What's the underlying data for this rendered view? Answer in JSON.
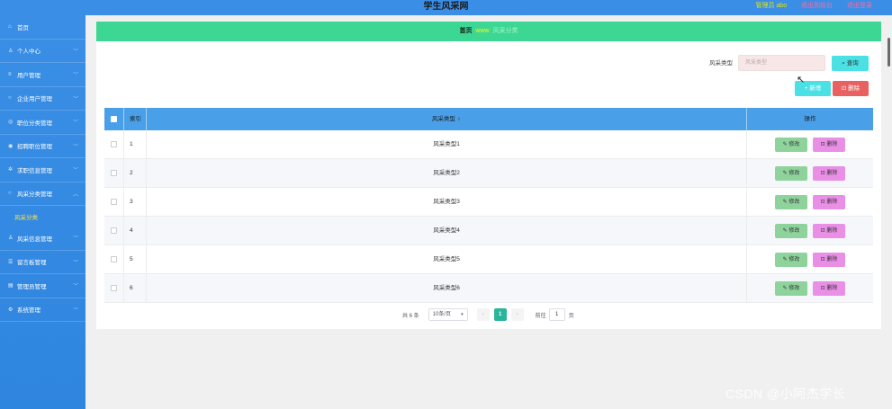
{
  "header": {
    "title": "学生风采网",
    "admin_label": "管理员 abo",
    "link1": "退出到前台",
    "link2": "退出登录"
  },
  "sidebar": {
    "items": [
      {
        "label": "首页",
        "icon": "home-icon"
      },
      {
        "label": "个人中心",
        "icon": "user-icon"
      },
      {
        "label": "用户管理",
        "icon": "users-icon"
      },
      {
        "label": "企业用户管理",
        "icon": "building-icon"
      },
      {
        "label": "职位分类管理",
        "icon": "category-icon"
      },
      {
        "label": "招聘职位管理",
        "icon": "briefcase-icon"
      },
      {
        "label": "求职信息管理",
        "icon": "info-icon"
      },
      {
        "label": "风采分类管理",
        "icon": "tag-icon"
      },
      {
        "label": "风采分类",
        "icon": ""
      },
      {
        "label": "风采信息管理",
        "icon": "star-icon"
      },
      {
        "label": "留言板管理",
        "icon": "message-icon"
      },
      {
        "label": "管理员管理",
        "icon": "admin-icon"
      },
      {
        "label": "系统管理",
        "icon": "gear-icon"
      }
    ]
  },
  "breadcrumb": {
    "home": "首页",
    "separator": "www",
    "current": "风采分类"
  },
  "search": {
    "label": "风采类型",
    "placeholder": "风采类型",
    "button": "查询"
  },
  "actions": {
    "add": "新增",
    "delete": "删除"
  },
  "table": {
    "columns": [
      "索引",
      "风采类型",
      "操作"
    ],
    "rows": [
      {
        "index": "1",
        "name": "风采类型1"
      },
      {
        "index": "2",
        "name": "风采类型2"
      },
      {
        "index": "3",
        "name": "风采类型3"
      },
      {
        "index": "4",
        "name": "风采类型4"
      },
      {
        "index": "5",
        "name": "风采类型5"
      },
      {
        "index": "6",
        "name": "风采类型6"
      }
    ],
    "edit_label": "修改",
    "delete_label": "删除"
  },
  "pagination": {
    "total": "共 6 条",
    "page_size": "10条/页",
    "prev": "‹",
    "current_page": "1",
    "next": "›",
    "goto_label": "前往",
    "goto_value": "1",
    "page_suffix": "页"
  },
  "watermark": "CSDN @小阿杰学长",
  "colors": {
    "sidebar": "#3a8ee6",
    "breadcrumb_bar": "#3cd792",
    "table_header": "#4aa0e8",
    "edit_button": "#8fd39c",
    "delete_button": "#e98fe6",
    "search_button": "#4ae0e4",
    "danger_button": "#e86060",
    "active_page": "#2ab59b"
  }
}
